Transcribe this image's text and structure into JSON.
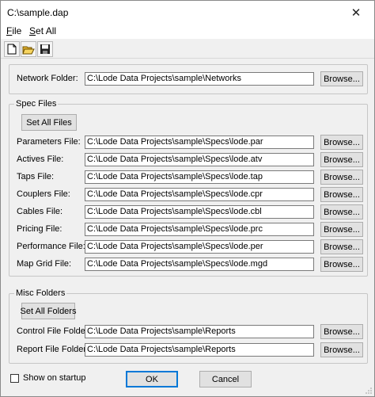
{
  "window": {
    "title": "C:\\sample.dap",
    "close_glyph": "✕"
  },
  "menu": {
    "file": "ile",
    "file_accel": "F",
    "set_all": "et All",
    "set_all_accel": "S"
  },
  "toolbar": {
    "icons": [
      "new-document-icon",
      "open-folder-icon",
      "save-disk-icon"
    ]
  },
  "network": {
    "label": "Network Folder:",
    "value": "C:\\Lode Data Projects\\sample\\Networks",
    "browse": "Browse..."
  },
  "spec_files": {
    "group_label": "Spec Files",
    "set_all": "Set All Files",
    "rows": [
      {
        "label": "Parameters File:",
        "value": "C:\\Lode Data Projects\\sample\\Specs\\lode.par",
        "browse": "Browse..."
      },
      {
        "label": "Actives File:",
        "value": "C:\\Lode Data Projects\\sample\\Specs\\lode.atv",
        "browse": "Browse..."
      },
      {
        "label": "Taps File:",
        "value": "C:\\Lode Data Projects\\sample\\Specs\\lode.tap",
        "browse": "Browse..."
      },
      {
        "label": "Couplers File:",
        "value": "C:\\Lode Data Projects\\sample\\Specs\\lode.cpr",
        "browse": "Browse..."
      },
      {
        "label": "Cables File:",
        "value": "C:\\Lode Data Projects\\sample\\Specs\\lode.cbl",
        "browse": "Browse..."
      },
      {
        "label": "Pricing File:",
        "value": "C:\\Lode Data Projects\\sample\\Specs\\lode.prc",
        "browse": "Browse..."
      },
      {
        "label": "Performance File:",
        "value": "C:\\Lode Data Projects\\sample\\Specs\\lode.per",
        "browse": "Browse..."
      },
      {
        "label": "Map Grid File:",
        "value": "C:\\Lode Data Projects\\sample\\Specs\\lode.mgd",
        "browse": "Browse..."
      }
    ]
  },
  "misc_folders": {
    "group_label": "Misc Folders",
    "set_all": "Set All Folders",
    "rows": [
      {
        "label": "Control File Folder:",
        "value": "C:\\Lode Data Projects\\sample\\Reports",
        "browse": "Browse..."
      },
      {
        "label": "Report File Folder:",
        "value": "C:\\Lode Data Projects\\sample\\Reports",
        "browse": "Browse..."
      }
    ]
  },
  "footer": {
    "show_on_startup": "Show on startup",
    "show_on_startup_checked": false,
    "ok": "OK",
    "cancel": "Cancel"
  }
}
